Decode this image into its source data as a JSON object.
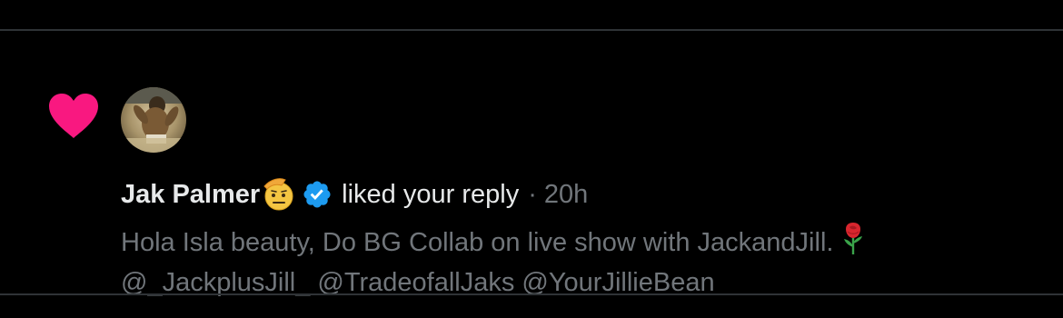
{
  "notification": {
    "type": "like",
    "user": {
      "name": "Jak Palmer",
      "name_emoji": "saluting-face-icon",
      "verified": true,
      "avatar": "user-avatar-photo"
    },
    "action_text": "liked your reply",
    "separator": "·",
    "timestamp": "20h",
    "reply": {
      "line1": "Hola Isla beauty, Do BG Collab on live show with JackandJill.",
      "line1_emoji": "rose-icon",
      "line2": "@_JackplusJill_ @TradeofallJaks @YourJillieBean"
    }
  },
  "colors": {
    "background": "#000000",
    "divider": "#2f3336",
    "primary_text": "#e7e9ea",
    "secondary_text": "#71767b",
    "heart": "#f91880",
    "verified_badge": "#1d9bf0"
  }
}
